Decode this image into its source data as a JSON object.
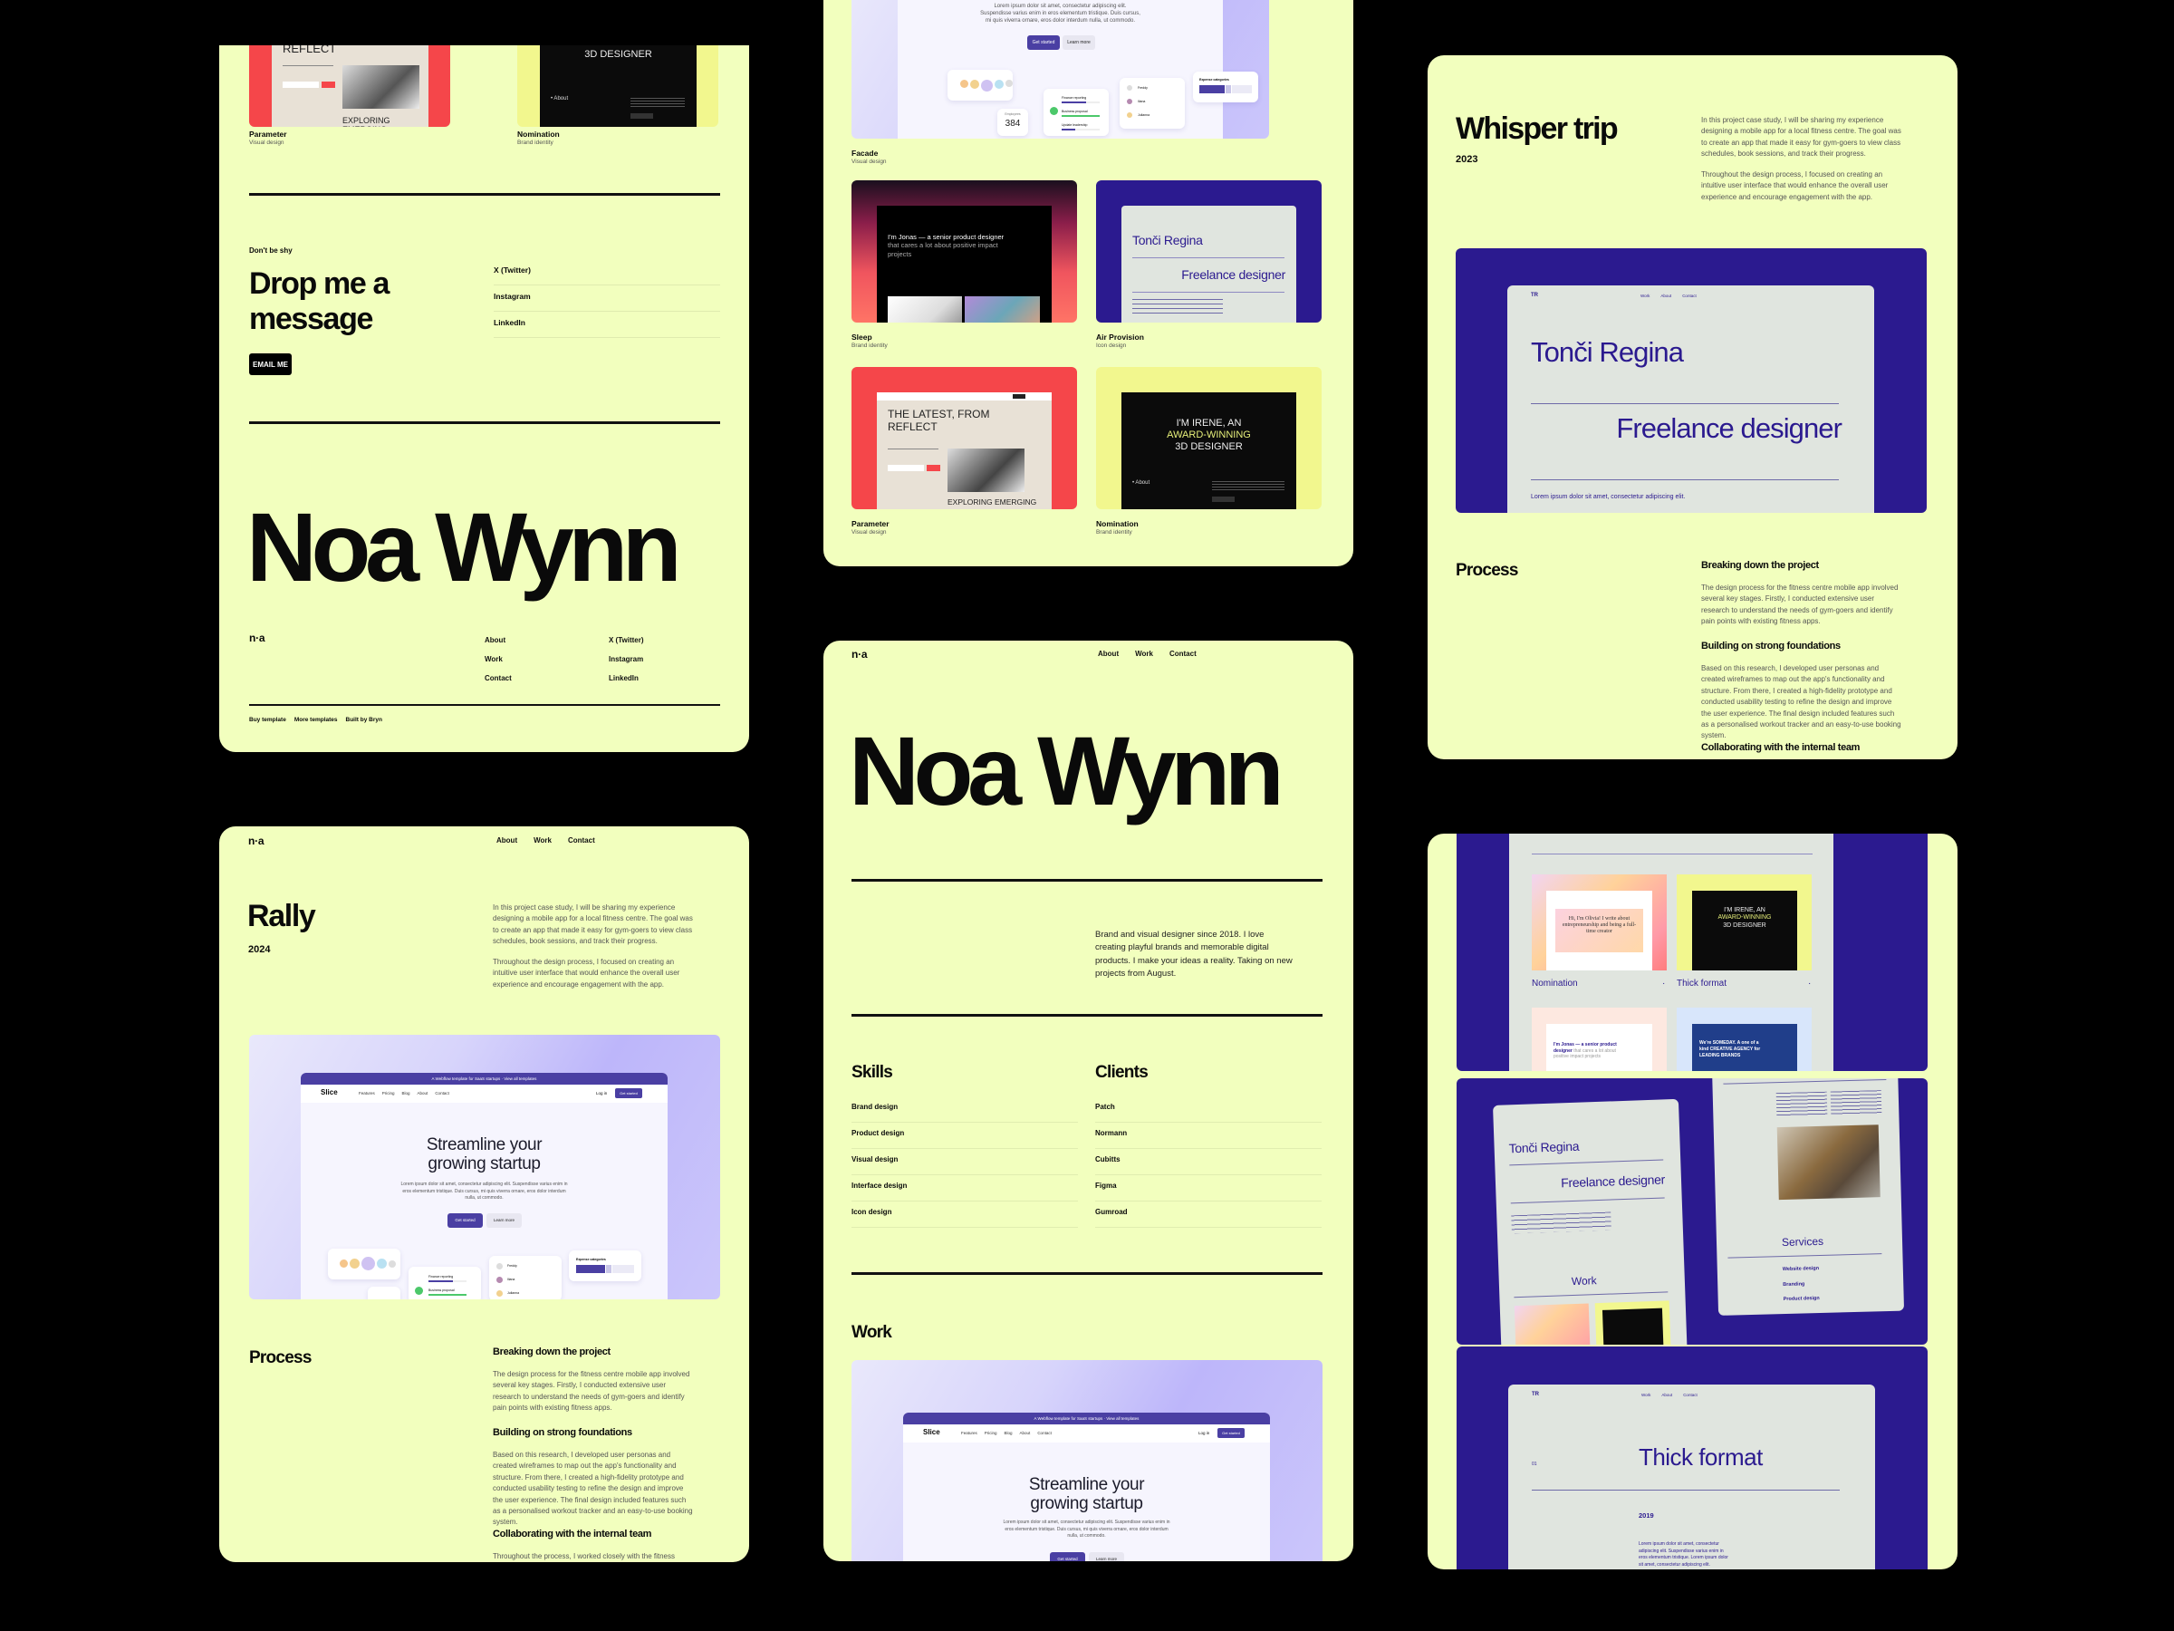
{
  "colors": {
    "background": "#000000",
    "card": "#f2ffbe",
    "slice_primary": "#4a3fa3",
    "tr_purple": "#2b1a8f",
    "tr_grey": "#e0e5df",
    "reflect_red": "#f5464a",
    "irene_yellow": "#f2f78e"
  },
  "brand": {
    "logo": "n·a",
    "name": "Noa Wynn"
  },
  "nav": {
    "about": "About",
    "work": "Work",
    "contact": "Contact"
  },
  "card1": {
    "projects": [
      {
        "title": "Parameter",
        "category": "Visual design",
        "mock_heading": "REFLECT",
        "mock_sub": "EXPLORING EMERGING"
      },
      {
        "title": "Nomination",
        "category": "Brand identity",
        "mock_heading": "3D DESIGNER",
        "mock_link": "• About"
      }
    ],
    "contact": {
      "eyebrow": "Don't be shy",
      "heading_line1": "Drop me a",
      "heading_line2": "message",
      "button": "EMAIL ME",
      "links": [
        "X (Twitter)",
        "Instagram",
        "LinkedIn"
      ]
    },
    "footer": {
      "big_name": "Noa Wynn",
      "logo": "n·a",
      "nav_links": [
        "About",
        "Work",
        "Contact"
      ],
      "social_links": [
        "X (Twitter)",
        "Instagram",
        "LinkedIn"
      ],
      "bottom_links": [
        "Buy template",
        "More templates",
        "Built by Bryn"
      ]
    }
  },
  "slice_mock": {
    "banner": "A Webflow template for SaaS startups · View all templates",
    "logo": "Slice",
    "nav": [
      "Features",
      "Pricing",
      "Blog",
      "About",
      "Contact"
    ],
    "login": "Log in",
    "cta": "Get started",
    "headline_1": "Streamline your",
    "headline_2": "growing startup",
    "body": "Lorem ipsum dolor sit amet, consectetur adipiscing elit. Suspendisse varius enim in eros elementum tristique. Duis cursus, mi quis viverra ornare, eros dolor interdum nulla, ut commodo.",
    "btn_primary": "Get started",
    "btn_secondary": "Learn more",
    "employees_label": "Employees",
    "employees_value": "384",
    "tasks": [
      {
        "label": "Finance reporting",
        "value": "64%",
        "progress": 0.64
      },
      {
        "label": "Business proposal",
        "value": "100%",
        "progress": 1.0
      },
      {
        "label": "Update leadership",
        "value": "35%",
        "progress": 0.35
      }
    ],
    "people": [
      {
        "name": "Freddy",
        "tag": "Marketing"
      },
      {
        "name": "Iliana",
        "tag": "Design"
      },
      {
        "name": "Julianna",
        "tag": "Finance"
      }
    ],
    "expense_title": "Expense categories"
  },
  "card2": {
    "projects": [
      {
        "title": "Facade",
        "category": "Visual design"
      },
      {
        "title": "Sleep",
        "category": "Brand identity",
        "mock_text_bold": "I'm Jonas — a senior product designer",
        "mock_text_rest": "that cares a lot about positive impact projects"
      },
      {
        "title": "Air Provision",
        "category": "Icon design",
        "mock_name": "Tonči Regina",
        "mock_role": "Freelance designer"
      },
      {
        "title": "Parameter",
        "category": "Visual design",
        "mock_heading": "THE LATEST, FROM REFLECT",
        "mock_sub": "EXPLORING EMERGING"
      },
      {
        "title": "Nomination",
        "category": "Brand identity",
        "mock_line1": "I'M IRENE, AN",
        "mock_line2": "AWARD-WINNING",
        "mock_line3": "3D DESIGNER",
        "mock_link": "• About"
      }
    ]
  },
  "card3": {
    "title": "Rally",
    "year": "2024",
    "intro_1": "In this project case study, I will be sharing my experience designing a mobile app for a local fitness centre. The goal was to create an app that made it easy for gym-goers to view class schedules, book sessions, and track their progress.",
    "intro_2": "Throughout the design process, I focused on creating an intuitive user interface that would enhance the overall user experience and encourage engagement with the app.",
    "process_heading": "Process",
    "steps": [
      {
        "title": "Breaking down the project",
        "body": "The design process for the fitness centre mobile app involved several key stages. Firstly, I conducted extensive user research to understand the needs of gym-goers and identify pain points with existing fitness apps."
      },
      {
        "title": "Building on strong foundations",
        "body": "Based on this research, I developed user personas and created wireframes to map out the app's functionality and structure. From there, I created a high-fidelity prototype and conducted usability testing to refine the design and improve the user experience. The final design included features such as a personalised workout tracker and an easy-to-use booking system."
      },
      {
        "title": "Collaborating with the internal team",
        "body": "Throughout the process, I worked closely with the fitness centre's"
      }
    ]
  },
  "card4": {
    "hero": "Noa Wynn",
    "bio": "Brand and visual designer since 2018. I love creating playful brands and memorable digital products. I make your ideas a reality. Taking on new projects from August.",
    "skills_heading": "Skills",
    "skills": [
      "Brand design",
      "Product design",
      "Visual design",
      "Interface design",
      "Icon design"
    ],
    "clients_heading": "Clients",
    "clients": [
      "Patch",
      "Normann",
      "Cubitts",
      "Figma",
      "Gumroad"
    ],
    "work_heading": "Work"
  },
  "card5": {
    "title": "Whisper trip",
    "year": "2023",
    "intro_1": "In this project case study, I will be sharing my experience designing a mobile app for a local fitness centre. The goal was to create an app that made it easy for gym-goers to view class schedules, book sessions, and track their progress.",
    "intro_2": "Throughout the design process, I focused on creating an intuitive user interface that would enhance the overall user experience and encourage engagement with the app.",
    "mock": {
      "logo": "TR",
      "nav": [
        "Work",
        "About",
        "Contact"
      ],
      "name": "Tonči Regina",
      "role": "Freelance designer",
      "body": "Lorem ipsum dolor sit amet, consectetur adipiscing elit."
    },
    "process_heading": "Process",
    "steps": [
      {
        "title": "Breaking down the project",
        "body": "The design process for the fitness centre mobile app involved several key stages. Firstly, I conducted extensive user research to understand the needs of gym-goers and identify pain points with existing fitness apps."
      },
      {
        "title": "Building on strong foundations",
        "body": "Based on this research, I developed user personas and created wireframes to map out the app's functionality and structure. From there, I created a high-fidelity prototype and conducted usability testing to refine the design and improve the user experience. The final design included features such as a personalised workout tracker and an easy-to-use booking system."
      },
      {
        "title": "Collaborating with the internal team"
      }
    ]
  },
  "card6": {
    "panel1": {
      "items": [
        {
          "title": "Nomination",
          "mock": "Hi, I'm Olivia! I write about entrepreneurship and being a full-time creator"
        },
        {
          "title": "Thick format",
          "mock_line1": "I'M IRENE, AN",
          "mock_line2": "AWARD-WINNING",
          "mock_line3": "3D DESIGNER"
        }
      ],
      "jonas_bold": "I'm Jonas — a senior product designer",
      "jonas_rest": "that cares a lot about positive impact projects",
      "someday": "We're SOMEDAY. A one of a kind CREATIVE AGENCY for LEADING BRANDS"
    },
    "panel2": {
      "name": "Tonči Regina",
      "role": "Freelance designer",
      "work": "Work",
      "services": "Services",
      "service_items": [
        "Website design",
        "Branding",
        "Product design"
      ]
    },
    "panel3": {
      "logo": "TR",
      "nav": [
        "Work",
        "About",
        "Contact"
      ],
      "index": "01",
      "title": "Thick format",
      "year": "2019",
      "body": "Lorem ipsum dolor sit amet, consectetur adipiscing elit. Suspendisse varius enim in eros elementum tristique. Lorem ipsum dolor sit amet, consectetur adipiscing elit."
    }
  }
}
